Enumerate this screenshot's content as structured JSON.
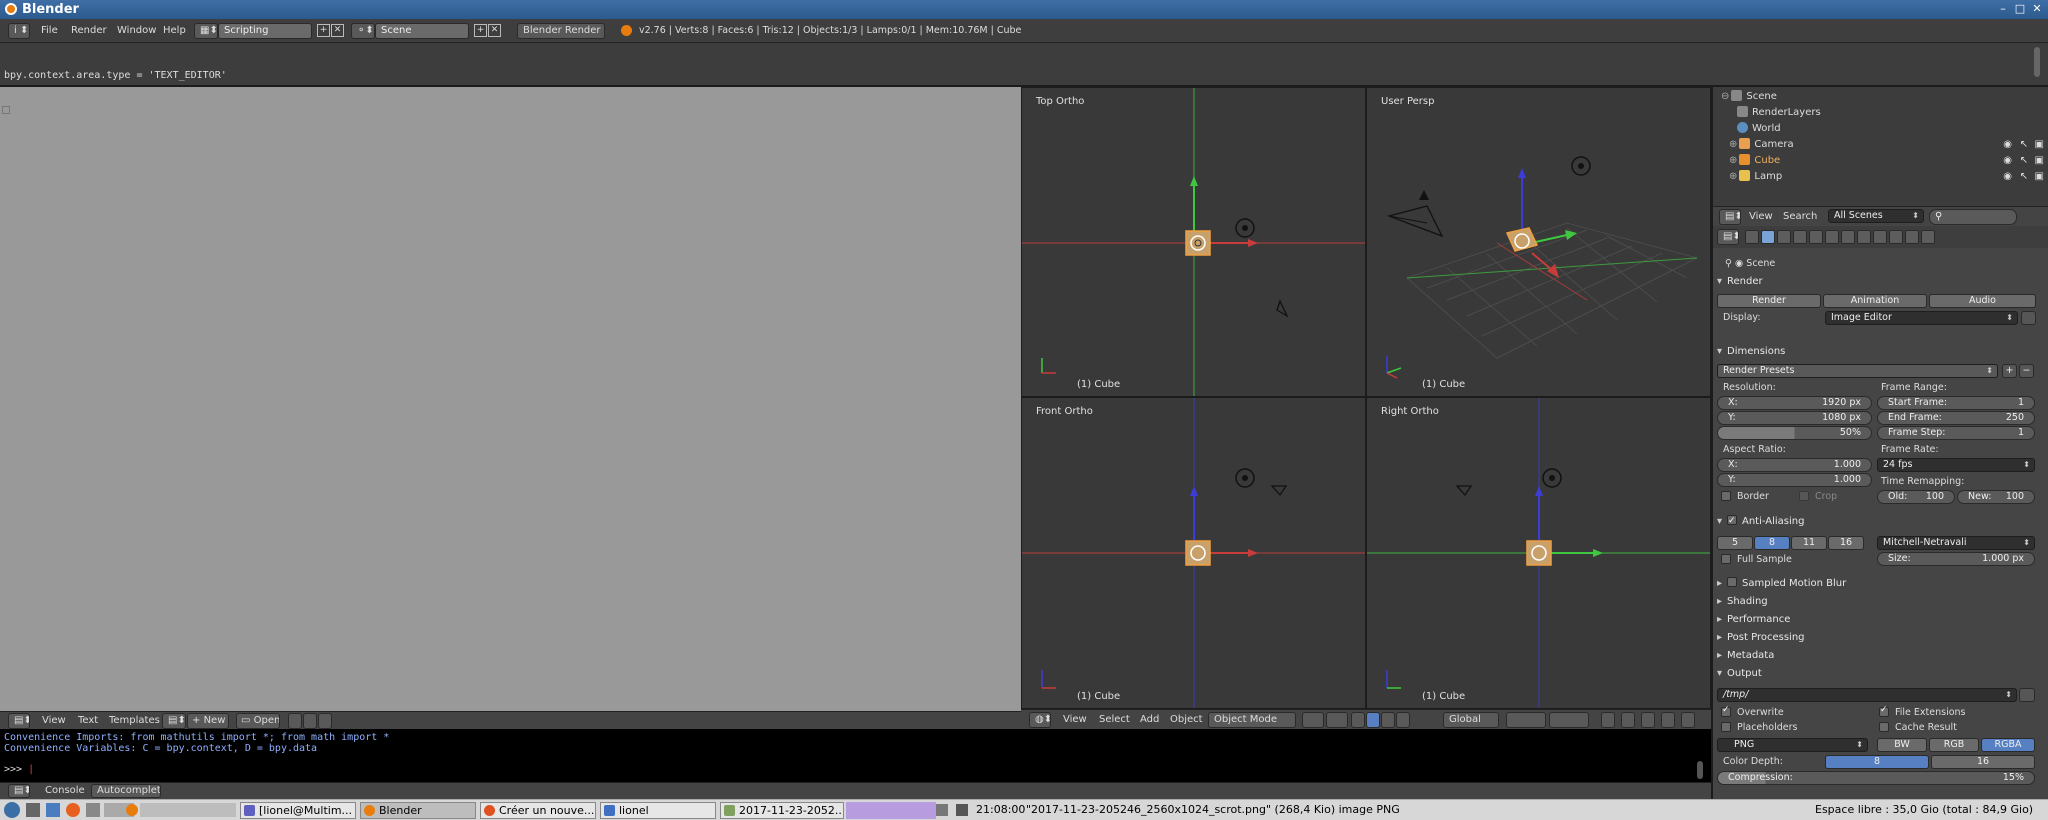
{
  "window": {
    "title": "Blender"
  },
  "info_header": {
    "menus": [
      "File",
      "Render",
      "Window",
      "Help"
    ],
    "screen_layout": "Scripting",
    "scene": "Scene",
    "render_engine": "Blender Render",
    "stats": "v2.76 | Verts:8 | Faces:6 | Tris:12 | Objects:1/3 | Lamps:0/1 | Mem:10.76M | Cube"
  },
  "python_console_top": {
    "line": "bpy.context.area.type = 'TEXT_EDITOR'"
  },
  "text_editor_header": {
    "menus": [
      "View",
      "Text",
      "Templates"
    ],
    "new_label": "New",
    "open_label": "Open"
  },
  "viewports": [
    {
      "label": "Top Ortho",
      "object": "(1) Cube"
    },
    {
      "label": "User Persp",
      "object": "(1) Cube"
    },
    {
      "label": "Front Ortho",
      "object": "(1) Cube"
    },
    {
      "label": "Right Ortho",
      "object": "(1) Cube"
    }
  ],
  "view3d_header": {
    "menus": [
      "View",
      "Select",
      "Add",
      "Object"
    ],
    "mode": "Object Mode",
    "orientation": "Global"
  },
  "console": {
    "lines": [
      "Convenience Imports: from mathutils import *; from math import *",
      "Convenience Variables: C = bpy.context, D = bpy.data"
    ],
    "prompt": ">>> "
  },
  "console_header": {
    "menus": [
      "Console",
      "Autocomplete"
    ]
  },
  "outliner": {
    "items": [
      {
        "label": "Scene",
        "color": "#a0a0a0"
      },
      {
        "label": "RenderLayers",
        "color": "#a0a0a0"
      },
      {
        "label": "World",
        "color": "#c86464"
      },
      {
        "label": "Camera",
        "color": "#e8a050"
      },
      {
        "label": "Cube",
        "color": "#e89030"
      },
      {
        "label": "Lamp",
        "color": "#e8c050"
      }
    ],
    "header": {
      "view": "View",
      "search": "Search",
      "filter": "All Scenes"
    }
  },
  "properties": {
    "context": "Scene",
    "render": {
      "title": "Render",
      "buttons": [
        "Render",
        "Animation",
        "Audio"
      ],
      "display_label": "Display:",
      "display_value": "Image Editor"
    },
    "dimensions": {
      "title": "Dimensions",
      "presets": "Render Presets",
      "resolution_label": "Resolution:",
      "res_x_label": "X:",
      "res_x": "1920 px",
      "res_y_label": "Y:",
      "res_y": "1080 px",
      "res_pct": "50%",
      "frame_range_label": "Frame Range:",
      "start_label": "Start Frame:",
      "start": "1",
      "end_label": "End Frame:",
      "end": "250",
      "step_label": "Frame Step:",
      "step": "1",
      "aspect_label": "Aspect Ratio:",
      "asp_x_label": "X:",
      "asp_x": "1.000",
      "asp_y_label": "Y:",
      "asp_y": "1.000",
      "frame_rate_label": "Frame Rate:",
      "frame_rate": "24 fps",
      "border_label": "Border",
      "crop_label": "Crop",
      "time_remap_label": "Time Remapping:",
      "old_label": "Old:",
      "old": "100",
      "new_label": "New:",
      "new": "100"
    },
    "anti_aliasing": {
      "title": "Anti-Aliasing",
      "samples": [
        "5",
        "8",
        "11",
        "16"
      ],
      "filter": "Mitchell-Netravali",
      "full_sample_label": "Full Sample",
      "size_label": "Size:",
      "size": "1.000 px"
    },
    "collapsed_panels": [
      "Sampled Motion Blur",
      "Shading",
      "Performance",
      "Post Processing",
      "Metadata"
    ],
    "output": {
      "title": "Output",
      "path": "/tmp/",
      "overwrite_label": "Overwrite",
      "file_ext_label": "File Extensions",
      "placeholders_label": "Placeholders",
      "cache_label": "Cache Result",
      "format": "PNG",
      "channels": [
        "BW",
        "RGB",
        "RGBA"
      ],
      "color_depth_label": "Color Depth:",
      "depths": [
        "8",
        "16"
      ],
      "compression_label": "Compression:",
      "compression": "15%"
    }
  },
  "taskbar": {
    "tasks": [
      {
        "label": "[lionel@Multim...",
        "color": "#6060c0"
      },
      {
        "label": "Blender",
        "color": "#e87d0d"
      },
      {
        "label": "Créer un nouve...",
        "color": "#e05020"
      },
      {
        "label": "lionel",
        "color": "#4070c0"
      },
      {
        "label": "2017-11-23-2052...",
        "color": "#80a060"
      }
    ],
    "clock": "21:08:00",
    "status": "\"2017-11-23-205246_2560x1024_scrot.png\" (268,4 Kio) image PNG",
    "disk": "Espace libre : 35,0 Gio (total : 84,9 Gio)"
  }
}
